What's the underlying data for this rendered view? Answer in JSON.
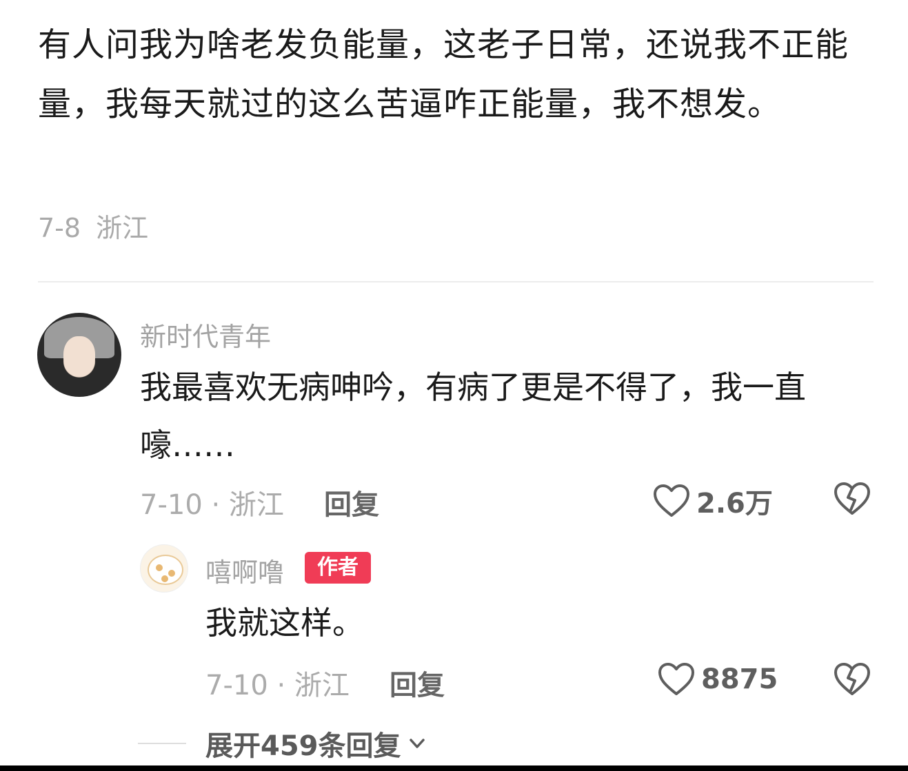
{
  "post": {
    "text": "有人问我为啥老发负能量，这老子日常，还说我不正能量，我每天就过的这么苦逼咋正能量，我不想发。",
    "date": "7-8",
    "location": "浙江"
  },
  "comment": {
    "avatar_icon": "user-avatar-hooded-person",
    "username": "新时代青年",
    "text": "我最喜欢无病呻吟，有病了更是不得了，我一直嚎……",
    "meta": "7-10 · 浙江",
    "reply_label": "回复",
    "like_icon": "heart-outline-icon",
    "like_count": "2.6万",
    "dislike_icon": "broken-heart-icon"
  },
  "reply": {
    "avatar_icon": "cat-avatar",
    "username": "嘻啊噜",
    "badge": "作者",
    "badge_color": "#f03c56",
    "text": "我就这样。",
    "meta": "7-10 · 浙江",
    "reply_label": "回复",
    "like_icon": "heart-outline-icon",
    "like_count": "8875",
    "dislike_icon": "broken-heart-icon"
  },
  "expand": {
    "label": "展开459条回复",
    "icon": "chevron-down-icon"
  }
}
